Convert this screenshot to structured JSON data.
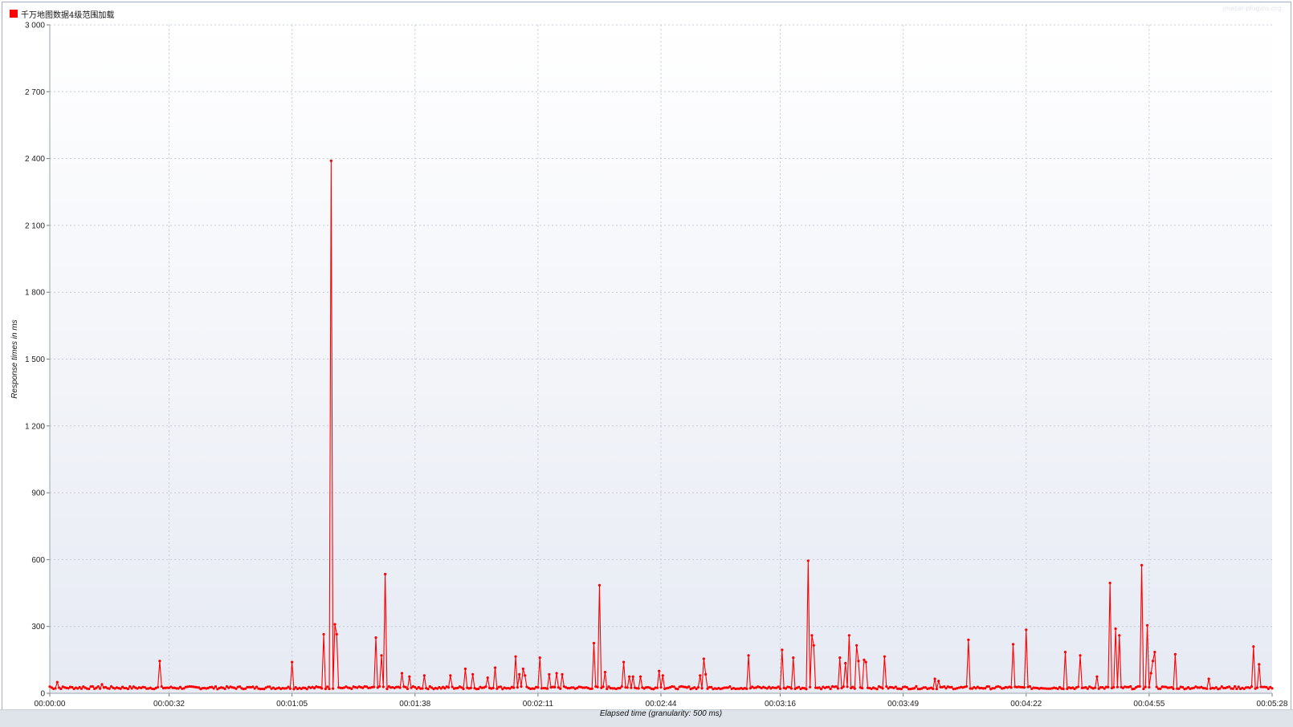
{
  "colors": {
    "series": "#ff0000",
    "grid": "#c5ccd8",
    "plot_bg_top": "#ffffff",
    "plot_bg_bottom": "#e6eaf3"
  },
  "watermark": "jmeter-plugins.org",
  "chart_data": {
    "type": "line",
    "title": "",
    "xlabel": "Elapsed time (granularity: 500 ms)",
    "ylabel": "Response times in ms",
    "ylim": [
      0,
      3000
    ],
    "xlim": [
      0,
      328
    ],
    "grid": true,
    "legend_position": "top-left",
    "y_ticks": [
      {
        "value": 0,
        "label": "0"
      },
      {
        "value": 300,
        "label": "300"
      },
      {
        "value": 600,
        "label": "600"
      },
      {
        "value": 900,
        "label": "900"
      },
      {
        "value": 1200,
        "label": "1 200"
      },
      {
        "value": 1500,
        "label": "1 500"
      },
      {
        "value": 1800,
        "label": "1 800"
      },
      {
        "value": 2100,
        "label": "2 100"
      },
      {
        "value": 2400,
        "label": "2 400"
      },
      {
        "value": 2700,
        "label": "2 700"
      },
      {
        "value": 3000,
        "label": "3 000"
      }
    ],
    "x_ticks": [
      {
        "value": 0,
        "label": "00:00:00"
      },
      {
        "value": 32,
        "label": "00:00:32"
      },
      {
        "value": 65,
        "label": "00:01:05"
      },
      {
        "value": 98,
        "label": "00:01:38"
      },
      {
        "value": 131,
        "label": "00:02:11"
      },
      {
        "value": 164,
        "label": "00:02:44"
      },
      {
        "value": 196,
        "label": "00:03:16"
      },
      {
        "value": 229,
        "label": "00:03:49"
      },
      {
        "value": 262,
        "label": "00:04:22"
      },
      {
        "value": 295,
        "label": "00:04:55"
      },
      {
        "value": 328,
        "label": "00:05:28"
      }
    ],
    "series": [
      {
        "name": "千万地图数据4级范围加载",
        "color": "#ff0000",
        "baseline_ms": 25,
        "x_step_s": 0.5,
        "spikes": [
          [
            0,
            30
          ],
          [
            2,
            50
          ],
          [
            9,
            30
          ],
          [
            14,
            40
          ],
          [
            29.5,
            145
          ],
          [
            65,
            140
          ],
          [
            73.5,
            265
          ],
          [
            75.5,
            2390
          ],
          [
            76.5,
            310
          ],
          [
            77,
            265
          ],
          [
            87.5,
            250
          ],
          [
            89,
            170
          ],
          [
            90,
            535
          ],
          [
            94.5,
            90
          ],
          [
            96.5,
            75
          ],
          [
            100.5,
            80
          ],
          [
            107.5,
            80
          ],
          [
            111.5,
            110
          ],
          [
            113.5,
            85
          ],
          [
            117.5,
            70
          ],
          [
            119.5,
            115
          ],
          [
            125,
            165
          ],
          [
            126,
            85
          ],
          [
            127,
            110
          ],
          [
            127.5,
            80
          ],
          [
            131.5,
            160
          ],
          [
            134,
            85
          ],
          [
            136,
            90
          ],
          [
            137.5,
            85
          ],
          [
            146,
            225
          ],
          [
            147.5,
            485
          ],
          [
            149,
            95
          ],
          [
            154,
            140
          ],
          [
            155.5,
            75
          ],
          [
            156.5,
            75
          ],
          [
            158.5,
            75
          ],
          [
            163.5,
            100
          ],
          [
            164.5,
            80
          ],
          [
            174.5,
            80
          ],
          [
            175.5,
            155
          ],
          [
            176,
            85
          ],
          [
            187.5,
            170
          ],
          [
            196.5,
            195
          ],
          [
            199.5,
            160
          ],
          [
            203.5,
            595
          ],
          [
            204.5,
            260
          ],
          [
            205,
            215
          ],
          [
            212,
            160
          ],
          [
            213.5,
            135
          ],
          [
            214.5,
            260
          ],
          [
            216.5,
            215
          ],
          [
            217,
            145
          ],
          [
            218.5,
            150
          ],
          [
            219,
            140
          ],
          [
            224,
            165
          ],
          [
            237.5,
            65
          ],
          [
            238.5,
            55
          ],
          [
            246.5,
            240
          ],
          [
            258.5,
            220
          ],
          [
            262,
            285
          ],
          [
            272.5,
            185
          ],
          [
            276.5,
            170
          ],
          [
            281,
            75
          ],
          [
            284.5,
            495
          ],
          [
            286,
            290
          ],
          [
            287,
            260
          ],
          [
            293,
            575
          ],
          [
            294.5,
            305
          ],
          [
            295.5,
            90
          ],
          [
            296,
            145
          ],
          [
            296.5,
            185
          ],
          [
            302,
            175
          ],
          [
            311,
            65
          ],
          [
            323,
            210
          ],
          [
            324.5,
            130
          ]
        ]
      }
    ]
  }
}
